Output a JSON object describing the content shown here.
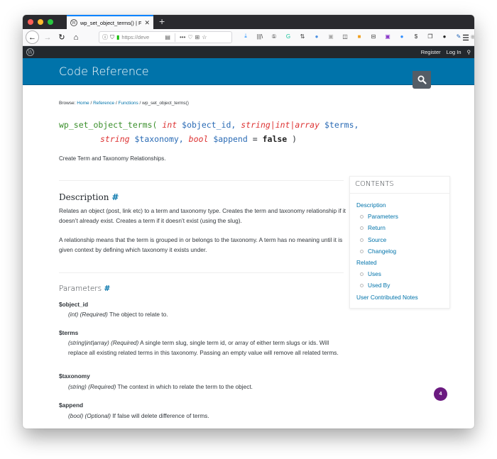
{
  "browser": {
    "tab_title": "wp_set_object_terms() | Functio",
    "tab_close": "✕",
    "new_tab": "+",
    "url": "https://deve",
    "nav": {
      "back": "←",
      "forward": "→",
      "reload": "↻",
      "home": "⌂"
    },
    "url_icons": {
      "info": "ⓘ",
      "shield": "⛉",
      "lock": "🔒",
      "reader": "▤",
      "more": "•••",
      "pocket": "♡",
      "screenshot": "⊞",
      "bookmark": "☆"
    },
    "extensions": [
      {
        "name": "download-icon",
        "glyph": "⤓",
        "color": "#0a84ff"
      },
      {
        "name": "library-icon",
        "glyph": "|||\\",
        "color": "#333333"
      },
      {
        "name": "one-password-icon",
        "glyph": "①",
        "color": "#333333"
      },
      {
        "name": "grammarly-icon",
        "glyph": "G",
        "color": "#15c39a"
      },
      {
        "name": "sort-icon",
        "glyph": "⇅",
        "color": "#333333"
      },
      {
        "name": "user-extension-icon",
        "glyph": "●",
        "color": "#4a90e2"
      },
      {
        "name": "gray-extension-icon",
        "glyph": "▣",
        "color": "#aaaaaa"
      },
      {
        "name": "sidebar-icon",
        "glyph": "◫",
        "color": "#333333"
      },
      {
        "name": "image-extension-icon",
        "glyph": "■",
        "color": "#f0a020"
      },
      {
        "name": "grid-extension-icon",
        "glyph": "⊟",
        "color": "#333333"
      },
      {
        "name": "purple-extension-icon",
        "glyph": "▣",
        "color": "#8a3ac9"
      },
      {
        "name": "zoom-extension-icon",
        "glyph": "●",
        "color": "#2d8cff"
      },
      {
        "name": "dollar-extension-icon",
        "glyph": "$",
        "color": "#333333"
      },
      {
        "name": "copy-extension-icon",
        "glyph": "❐",
        "color": "#333333"
      },
      {
        "name": "black-extension-icon",
        "glyph": "●",
        "color": "#222222"
      },
      {
        "name": "eyedropper-icon",
        "glyph": "✎",
        "color": "#1a5fb4"
      },
      {
        "name": "disabled-extension-icon",
        "glyph": "◉",
        "color": "#bbbbbb"
      }
    ],
    "menu": "☰"
  },
  "wpbar": {
    "logo": "W",
    "register": "Register",
    "login": "Log In",
    "search": "⚲"
  },
  "header": {
    "title": "Code Reference"
  },
  "breadcrumb": {
    "prefix": "Browse:",
    "items": [
      "Home",
      "Reference",
      "Functions"
    ],
    "current": "wp_set_object_terms()",
    "sep": "/"
  },
  "signature": {
    "name": "wp_set_object_terms(",
    "p1_type": "int",
    "p1_var": "$object_id,",
    "p2_type": "string|int|array",
    "p2_var": "$terms,",
    "p3_type": "string",
    "p3_var": "$taxonomy,",
    "p4_type": "bool",
    "p4_var": "$append",
    "eq": "=",
    "default": "false",
    "close": ")"
  },
  "summary": "Create Term and Taxonomy Relationships.",
  "description": {
    "heading": "Description",
    "hash": "#",
    "p1": "Relates an object (post, link etc) to a term and taxonomy type. Creates the term and taxonomy relationship if it doesn’t already exist. Creates a term if it doesn’t exist (using the slug).",
    "p2": "A relationship means that the term is grouped in or belongs to the taxonomy. A term has no meaning until it is given context by defining which taxonomy it exists under."
  },
  "parameters": {
    "heading": "Parameters",
    "hash": "#",
    "items": [
      {
        "name": "$object_id",
        "type": "(int)",
        "req": "(Required)",
        "desc": "The object to relate to."
      },
      {
        "name": "$terms",
        "type": "(string|int|array)",
        "req": "(Required)",
        "desc": "A single term slug, single term id, or array of either term slugs or ids. Will replace all existing related terms in this taxonomy. Passing an empty value will remove all related terms."
      },
      {
        "name": "$taxonomy",
        "type": "(string)",
        "req": "(Required)",
        "desc": "The context in which to relate the term to the object."
      },
      {
        "name": "$append",
        "type": "(bool)",
        "req": "(Optional)",
        "desc": "If false will delete difference of terms."
      }
    ]
  },
  "toc": {
    "title": "CONTENTS",
    "items": [
      {
        "label": "Description",
        "sub": false
      },
      {
        "label": "Parameters",
        "sub": true
      },
      {
        "label": "Return",
        "sub": true
      },
      {
        "label": "Source",
        "sub": true
      },
      {
        "label": "Changelog",
        "sub": true
      },
      {
        "label": "Related",
        "sub": false
      },
      {
        "label": "Uses",
        "sub": true
      },
      {
        "label": "Used By",
        "sub": true
      },
      {
        "label": "User Contributed Notes",
        "sub": false
      }
    ]
  },
  "badge": {
    "count": "4",
    "color": "#6b1a80"
  },
  "colors": {
    "accent": "#0073aa",
    "adminbar": "#23282d"
  }
}
